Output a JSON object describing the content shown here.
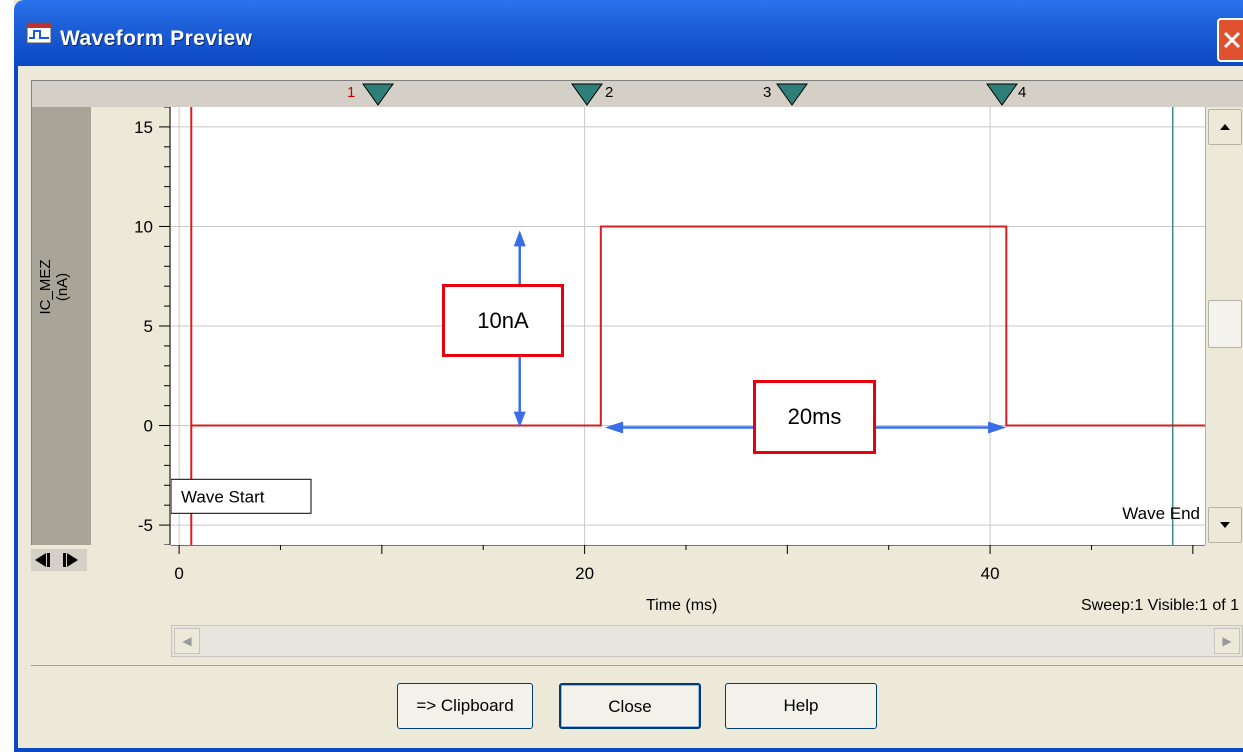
{
  "window": {
    "title": "Waveform Preview",
    "icon": "waveform-app-icon",
    "close_icon": "close-x-icon"
  },
  "markers": [
    {
      "label": "1",
      "color": "#cc0000"
    },
    {
      "label": "2",
      "color": "#000000"
    },
    {
      "label": "3",
      "color": "#000000"
    },
    {
      "label": "4",
      "color": "#000000"
    }
  ],
  "y_axis": {
    "label": "IC_MEZ",
    "unit": "(nA)"
  },
  "chart_data": {
    "type": "line",
    "xlabel": "Time (ms)",
    "ylabel": "IC_MEZ (nA)",
    "xlim": [
      -0.4,
      50.6
    ],
    "ylim": [
      -6,
      16
    ],
    "x_ticks": [
      0,
      20,
      40
    ],
    "y_ticks": [
      -5,
      0,
      5,
      10,
      15
    ],
    "grid": true,
    "series": [
      {
        "color": "#d42020",
        "x": [
          0.6,
          20.8,
          20.8,
          40.8,
          40.8,
          50.6
        ],
        "y": [
          0,
          0,
          10,
          10,
          0,
          0
        ]
      }
    ],
    "annotations": [
      {
        "text": "Wave Start",
        "x": 0.6
      },
      {
        "text": "Wave End",
        "x": 49.6
      }
    ]
  },
  "annotations": {
    "amplitude_label": "10nA",
    "duration_label": "20ms"
  },
  "status": {
    "sweep": "Sweep:1 Visible:1 of 1"
  },
  "buttons": {
    "clipboard": "=> Clipboard",
    "close": "Close",
    "help": "Help"
  },
  "colors": {
    "titlebar": "#0a48c4",
    "trace": "#d42020",
    "arrow": "#3a6ee8",
    "annotation_border": "#e8000d",
    "marker_triangle": "#2e7f7a"
  }
}
